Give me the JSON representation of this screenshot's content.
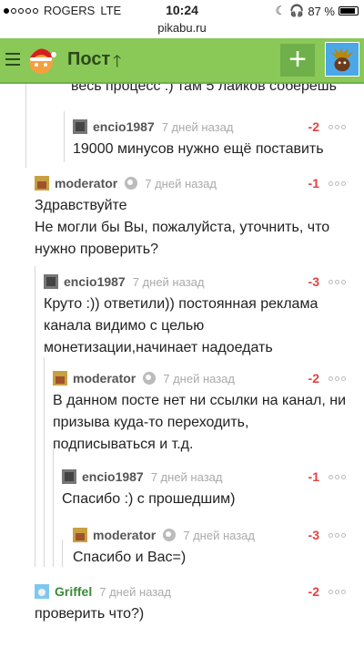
{
  "status": {
    "carrier": "ROGERS",
    "network": "LTE",
    "time": "10:24",
    "battery": "87 %"
  },
  "url": "pikabu.ru",
  "topbar": {
    "title": "Пост",
    "plus": "+"
  },
  "partial_text": "весь процесс :) там 5 лайков соберёшь",
  "comments": [
    {
      "author": "encio1987",
      "time": "7 дней назад",
      "rating": "-2",
      "text": "19000 минусов нужно ещё поставить"
    },
    {
      "author": "moderator",
      "time": "7 дней назад",
      "rating": "-1",
      "text": "Здравствуйте\nНе могли бы Вы, пожалуйста, уточнить, что нужно проверить?"
    },
    {
      "author": "encio1987",
      "time": "7 дней назад",
      "rating": "-3",
      "text": "Круто :)) ответили)) постоянная реклама канала видимо с целью монетизации,начинает надоедать"
    },
    {
      "author": "moderator",
      "time": "7 дней назад",
      "rating": "-2",
      "text": "В данном посте нет ни ссылки на канал, ни призыва куда-то переходить, подписываться и т.д."
    },
    {
      "author": "encio1987",
      "time": "7 дней назад",
      "rating": "-1",
      "text": "Спасибо :) с прошедшим)"
    },
    {
      "author": "moderator",
      "time": "7 дней назад",
      "rating": "-3",
      "text": "Спасибо и Вас=)"
    },
    {
      "author": "Griffel",
      "time": "7 дней назад",
      "rating": "-2",
      "text": "проверить что?)"
    }
  ],
  "colors": {
    "header_green": "#8ac858",
    "rating_red": "#e84040",
    "author_green": "#3a8a3a"
  }
}
